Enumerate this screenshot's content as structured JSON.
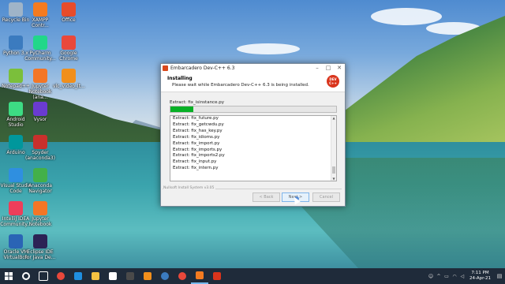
{
  "desktop": {
    "icons": [
      {
        "label": "Recycle Bin",
        "color": "#9fb4c8"
      },
      {
        "label": "XAMPP Contr...",
        "color": "#f47b20"
      },
      {
        "label": "Office",
        "color": "#e74c2b"
      },
      {
        "label": "Python 3.x",
        "color": "#3b7bbf"
      },
      {
        "label": "PyCharm Community...",
        "color": "#21d789"
      },
      {
        "label": "Google Chrome",
        "color": "#e9483b"
      },
      {
        "label": "Notepad++",
        "color": "#7bbf3b"
      },
      {
        "label": "Jupyter Notebook (ana...",
        "color": "#f37626"
      },
      {
        "label": "vlc_video_lt...",
        "color": "#f18f1c"
      },
      {
        "label": "Android Studio",
        "color": "#3ddc84"
      },
      {
        "label": "Vysor",
        "color": "#6a3bd1"
      },
      {
        "label": "Arduino",
        "color": "#00979c"
      },
      {
        "label": "Spyder (anaconda3)",
        "color": "#c9302c"
      },
      {
        "label": "Visual Studio Code",
        "color": "#2f8fe0"
      },
      {
        "label": "Anaconda Navigator",
        "color": "#43b049"
      },
      {
        "label": "IntelliJ IDEA Community...",
        "color": "#ee3e5a"
      },
      {
        "label": "Jupyter Notebook",
        "color": "#f37626"
      },
      {
        "label": "Oracle VM VirtualBox",
        "color": "#2a64b5"
      },
      {
        "label": "Eclipse IDE for Java De...",
        "color": "#2c2255"
      }
    ]
  },
  "installer": {
    "window_title": "Embarcadero Dev-C++ 6.3",
    "heading": "Installing",
    "subheading": "Please wait while Embarcadero Dev-C++ 6.3 is being installed.",
    "logo_text": "DEV C++",
    "current_action": "Extract: fix_isinstance.py",
    "progress_percent": 14,
    "log_lines": [
      "Extract: fix_future.py",
      "Extract: fix_getcwdu.py",
      "Extract: fix_has_key.py",
      "Extract: fix_idioms.py",
      "Extract: fix_import.py",
      "Extract: fix_imports.py",
      "Extract: fix_imports2.py",
      "Extract: fix_input.py",
      "Extract: fix_intern.py"
    ],
    "branding": "Nullsoft Install System v3.05",
    "buttons": {
      "back": "< Back",
      "next": "Next >",
      "cancel": "Cancel"
    }
  },
  "taskbar": {
    "apps": [
      {
        "icon": "search-icon",
        "color": "#ffffff"
      },
      {
        "icon": "task-view-icon",
        "color": "#ffffff"
      },
      {
        "icon": "chrome-icon",
        "color": "#e9483b"
      },
      {
        "icon": "edge-icon",
        "color": "#1f8fe0"
      },
      {
        "icon": "file-explorer-icon",
        "color": "#f5c242"
      },
      {
        "icon": "store-icon",
        "color": "#ffffff"
      },
      {
        "icon": "terminal-icon",
        "color": "#4a4a4a"
      },
      {
        "icon": "vlc-icon",
        "color": "#f18f1c"
      },
      {
        "icon": "python-icon",
        "color": "#3b7bbf"
      },
      {
        "icon": "chrome-icon",
        "color": "#e9483b"
      },
      {
        "icon": "installer-icon",
        "color": "#f47b20"
      },
      {
        "icon": "app-icon",
        "color": "#d9341c"
      }
    ],
    "time": "7:11 PM",
    "date": "24-Apr-21"
  }
}
